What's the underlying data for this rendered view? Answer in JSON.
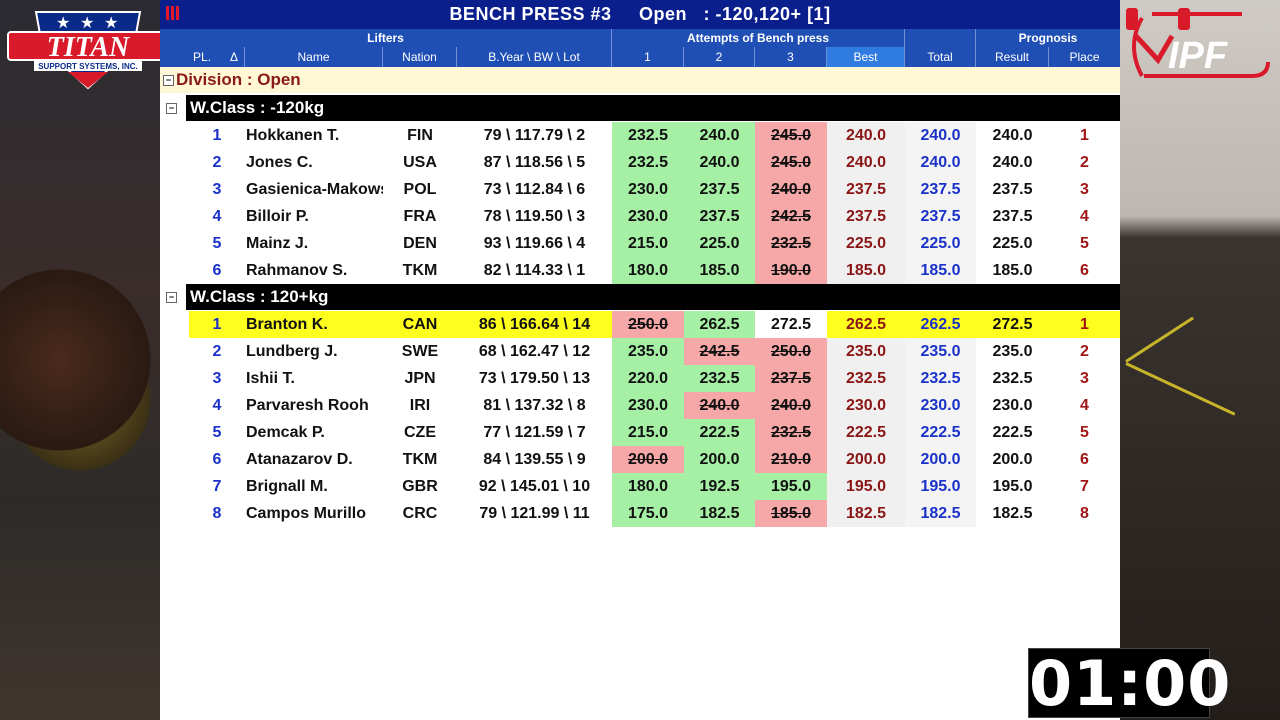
{
  "title": "BENCH PRESS #3     Open   : -120,120+ [1]",
  "logos": {
    "left_text": "TITAN",
    "left_sub": "SUPPORT SYSTEMS, INC.",
    "right_text": "IPF"
  },
  "header_groups": {
    "lifters": "Lifters",
    "attempts": "Attempts of Bench press",
    "prognosis": "Prognosis"
  },
  "columns": {
    "pl": "PL.",
    "sort": "Δ",
    "name": "Name",
    "nation": "Nation",
    "info": "B.Year \\ BW \\ Lot",
    "a1": "1",
    "a2": "2",
    "a3": "3",
    "best": "Best",
    "total": "Total",
    "result": "Result",
    "place": "Place"
  },
  "division": "Division : Open",
  "groups": [
    {
      "label": "W.Class : -120kg",
      "rows": [
        {
          "pl": "1",
          "name": "Hokkanen T.",
          "nation": "FIN",
          "info": "79 \\ 117.79 \\ 2",
          "a1": "232.5",
          "a1s": "good",
          "a2": "240.0",
          "a2s": "good",
          "a3": "245.0",
          "a3s": "bad",
          "best": "240.0",
          "total": "240.0",
          "result": "240.0",
          "place": "1"
        },
        {
          "pl": "2",
          "name": "Jones C.",
          "nation": "USA",
          "info": "87 \\ 118.56 \\ 5",
          "a1": "232.5",
          "a1s": "good",
          "a2": "240.0",
          "a2s": "good",
          "a3": "245.0",
          "a3s": "bad",
          "best": "240.0",
          "total": "240.0",
          "result": "240.0",
          "place": "2"
        },
        {
          "pl": "3",
          "name": "Gasienica-Makowski",
          "nation": "POL",
          "info": "73 \\ 112.84 \\ 6",
          "a1": "230.0",
          "a1s": "good",
          "a2": "237.5",
          "a2s": "good",
          "a3": "240.0",
          "a3s": "bad",
          "best": "237.5",
          "total": "237.5",
          "result": "237.5",
          "place": "3"
        },
        {
          "pl": "4",
          "name": "Billoir P.",
          "nation": "FRA",
          "info": "78 \\ 119.50 \\ 3",
          "a1": "230.0",
          "a1s": "good",
          "a2": "237.5",
          "a2s": "good",
          "a3": "242.5",
          "a3s": "bad",
          "best": "237.5",
          "total": "237.5",
          "result": "237.5",
          "place": "4"
        },
        {
          "pl": "5",
          "name": "Mainz J.",
          "nation": "DEN",
          "info": "93 \\ 119.66 \\ 4",
          "a1": "215.0",
          "a1s": "good",
          "a2": "225.0",
          "a2s": "good",
          "a3": "232.5",
          "a3s": "bad",
          "best": "225.0",
          "total": "225.0",
          "result": "225.0",
          "place": "5"
        },
        {
          "pl": "6",
          "name": "Rahmanov S.",
          "nation": "TKM",
          "info": "82 \\ 114.33 \\ 1",
          "a1": "180.0",
          "a1s": "good",
          "a2": "185.0",
          "a2s": "good",
          "a3": "190.0",
          "a3s": "bad",
          "best": "185.0",
          "total": "185.0",
          "result": "185.0",
          "place": "6"
        }
      ]
    },
    {
      "label": "W.Class : 120+kg",
      "rows": [
        {
          "pl": "1",
          "name": "Branton K.",
          "nation": "CAN",
          "info": "86 \\ 166.64 \\ 14",
          "a1": "250.0",
          "a1s": "bad",
          "a2": "262.5",
          "a2s": "good",
          "a3": "272.5",
          "a3s": "open",
          "best": "262.5",
          "total": "262.5",
          "result": "272.5",
          "place": "1",
          "highlight": true
        },
        {
          "pl": "2",
          "name": "Lundberg J.",
          "nation": "SWE",
          "info": "68 \\ 162.47 \\ 12",
          "a1": "235.0",
          "a1s": "good",
          "a2": "242.5",
          "a2s": "bad",
          "a3": "250.0",
          "a3s": "bad",
          "best": "235.0",
          "total": "235.0",
          "result": "235.0",
          "place": "2"
        },
        {
          "pl": "3",
          "name": "Ishii T.",
          "nation": "JPN",
          "info": "73 \\ 179.50 \\ 13",
          "a1": "220.0",
          "a1s": "good",
          "a2": "232.5",
          "a2s": "good",
          "a3": "237.5",
          "a3s": "bad",
          "best": "232.5",
          "total": "232.5",
          "result": "232.5",
          "place": "3"
        },
        {
          "pl": "4",
          "name": "Parvaresh Rooh",
          "nation": "IRI",
          "info": "81 \\ 137.32 \\ 8",
          "a1": "230.0",
          "a1s": "good",
          "a2": "240.0",
          "a2s": "bad",
          "a3": "240.0",
          "a3s": "bad",
          "best": "230.0",
          "total": "230.0",
          "result": "230.0",
          "place": "4"
        },
        {
          "pl": "5",
          "name": "Demcak P.",
          "nation": "CZE",
          "info": "77 \\ 121.59 \\ 7",
          "a1": "215.0",
          "a1s": "good",
          "a2": "222.5",
          "a2s": "good",
          "a3": "232.5",
          "a3s": "bad",
          "best": "222.5",
          "total": "222.5",
          "result": "222.5",
          "place": "5"
        },
        {
          "pl": "6",
          "name": "Atanazarov D.",
          "nation": "TKM",
          "info": "84 \\ 139.55 \\ 9",
          "a1": "200.0",
          "a1s": "bad",
          "a2": "200.0",
          "a2s": "good",
          "a3": "210.0",
          "a3s": "bad",
          "best": "200.0",
          "total": "200.0",
          "result": "200.0",
          "place": "6"
        },
        {
          "pl": "7",
          "name": "Brignall M.",
          "nation": "GBR",
          "info": "92 \\ 145.01 \\ 10",
          "a1": "180.0",
          "a1s": "good",
          "a2": "192.5",
          "a2s": "good",
          "a3": "195.0",
          "a3s": "good",
          "best": "195.0",
          "total": "195.0",
          "result": "195.0",
          "place": "7"
        },
        {
          "pl": "8",
          "name": "Campos Murillo",
          "nation": "CRC",
          "info": "79 \\ 121.99 \\ 11",
          "a1": "175.0",
          "a1s": "good",
          "a2": "182.5",
          "a2s": "good",
          "a3": "185.0",
          "a3s": "bad",
          "best": "182.5",
          "total": "182.5",
          "result": "182.5",
          "place": "8"
        }
      ]
    }
  ],
  "timer": "01:00",
  "colors": {
    "title_bar": "#0a1e8c",
    "header": "#1f4fb4",
    "good_lift": "#a6f0a6",
    "bad_lift": "#f6a8a8",
    "current_lifter": "#ffff1e"
  }
}
